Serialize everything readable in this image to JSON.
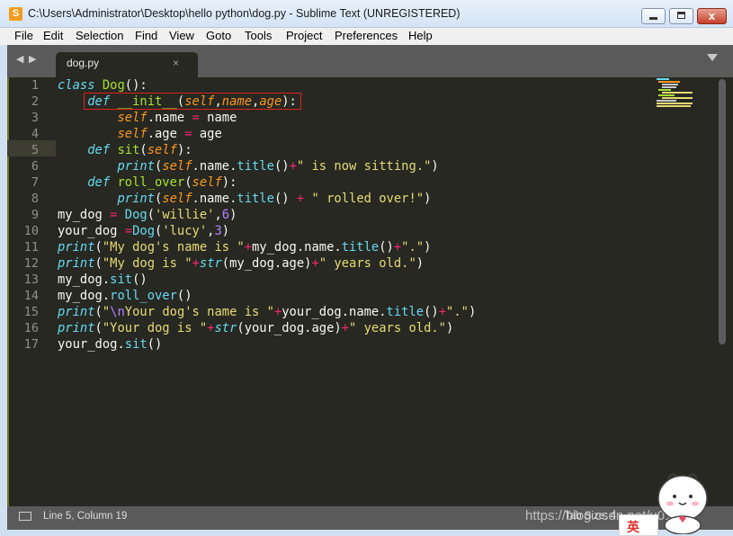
{
  "window": {
    "title": "C:\\Users\\Administrator\\Desktop\\hello python\\dog.py - Sublime Text (UNREGISTERED)",
    "app_icon": "sublime-text-icon",
    "close_glyph": "x"
  },
  "menu": [
    "File",
    "Edit",
    "Selection",
    "Find",
    "View",
    "Goto",
    "Tools",
    "Project",
    "Preferences",
    "Help"
  ],
  "tabs": {
    "nav_left": "◀",
    "nav_right": "▶",
    "active": {
      "label": "dog.py",
      "close": "×"
    }
  },
  "editor": {
    "active_line": 5,
    "highlighted_line": 2,
    "lines": [
      {
        "n": "1",
        "code": "class Dog():"
      },
      {
        "n": "2",
        "code": "    def __init__(self,name,age):"
      },
      {
        "n": "3",
        "code": "        self.name = name"
      },
      {
        "n": "4",
        "code": "        self.age = age"
      },
      {
        "n": "5",
        "code": "    def sit(self):"
      },
      {
        "n": "6",
        "code": "        print(self.name.title()+\" is now sitting.\")"
      },
      {
        "n": "7",
        "code": "    def roll_over(self):"
      },
      {
        "n": "8",
        "code": "        print(self.name.title() + \" rolled over!\")"
      },
      {
        "n": "9",
        "code": "my_dog = Dog('willie',6)"
      },
      {
        "n": "10",
        "code": "your_dog =Dog('lucy',3)"
      },
      {
        "n": "11",
        "code": "print(\"My dog's name is \"+my_dog.name.title()+\".\")"
      },
      {
        "n": "12",
        "code": "print(\"My dog is \"+str(my_dog.age)+\" years old.\")"
      },
      {
        "n": "13",
        "code": "my_dog.sit()"
      },
      {
        "n": "14",
        "code": "my_dog.roll_over()"
      },
      {
        "n": "15",
        "code": "print(\"\\nYour dog's name is \"+your_dog.name.title()+\".\")"
      },
      {
        "n": "16",
        "code": "print(\"Your dog is \"+str(your_dog.age)+\" years old.\")"
      },
      {
        "n": "17",
        "code": "your_dog.sit()"
      }
    ]
  },
  "status": {
    "position": "Line 5, Column 19",
    "right": "Tab Size: 4"
  },
  "watermark": "https://blog.csdn.net/u012...",
  "ime": {
    "label": "英"
  },
  "colors": {
    "background": "#272822",
    "keyword": "#66d9ef",
    "function": "#a6e22e",
    "string": "#e6db74",
    "param": "#fd971f",
    "operator": "#f92672",
    "number": "#ae81ff",
    "highlight_box": "#e0231a"
  }
}
